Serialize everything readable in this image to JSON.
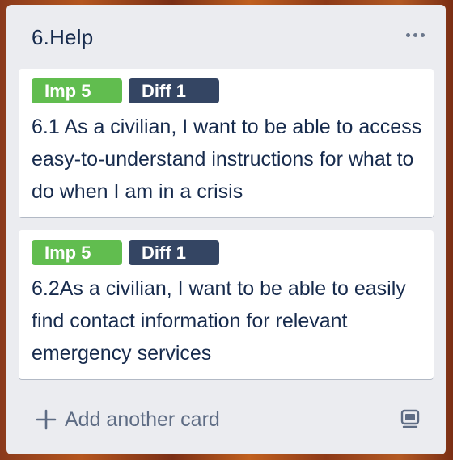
{
  "list": {
    "title": "6.Help",
    "menu_icon": "more-horizontal-icon"
  },
  "cards": [
    {
      "labels": [
        {
          "text": "Imp 5",
          "color": "#61bd4f"
        },
        {
          "text": "Diff 1",
          "color": "#344563"
        }
      ],
      "text": "6.1 As a civilian, I want to be able to access easy-to-understand instructions for what to do when I am in a crisis"
    },
    {
      "labels": [
        {
          "text": "Imp 5",
          "color": "#61bd4f"
        },
        {
          "text": "Diff 1",
          "color": "#344563"
        }
      ],
      "text": "6.2As a civilian, I want to be able to easily find contact information for relevant emergency services"
    }
  ],
  "footer": {
    "add_card_label": "Add another card",
    "add_icon": "plus-icon",
    "template_icon": "card-template-icon"
  }
}
